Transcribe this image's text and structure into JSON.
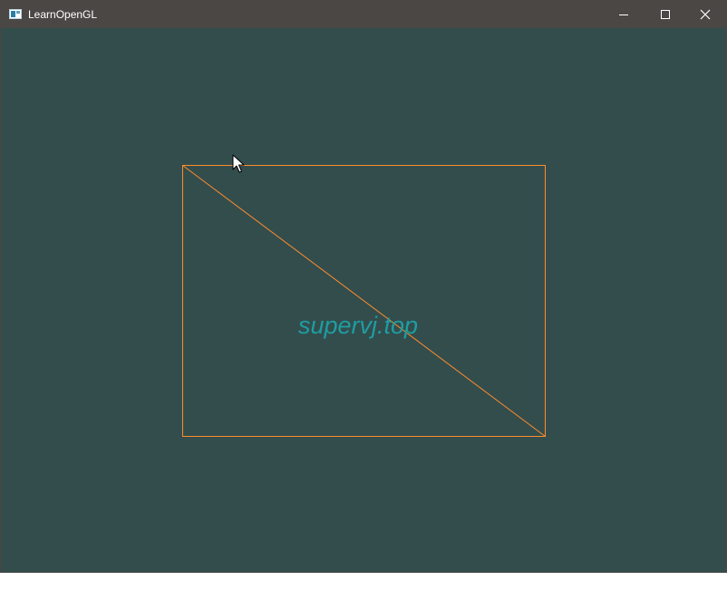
{
  "window": {
    "title": "LearnOpenGL",
    "background_color": "#334d4d",
    "titlebar_color": "#4a4744",
    "controls": [
      {
        "name": "minimize",
        "icon": "minimize-icon"
      },
      {
        "name": "maximize",
        "icon": "maximize-icon"
      },
      {
        "name": "close",
        "icon": "close-icon"
      }
    ]
  },
  "scene": {
    "wireframe_color": "#ff8c2a",
    "shape": "rectangle wireframe with diagonal"
  },
  "watermark": {
    "text": "supervj.top",
    "color": "#1e9da2"
  },
  "cursor": {
    "icon": "arrow-pointer-icon"
  }
}
